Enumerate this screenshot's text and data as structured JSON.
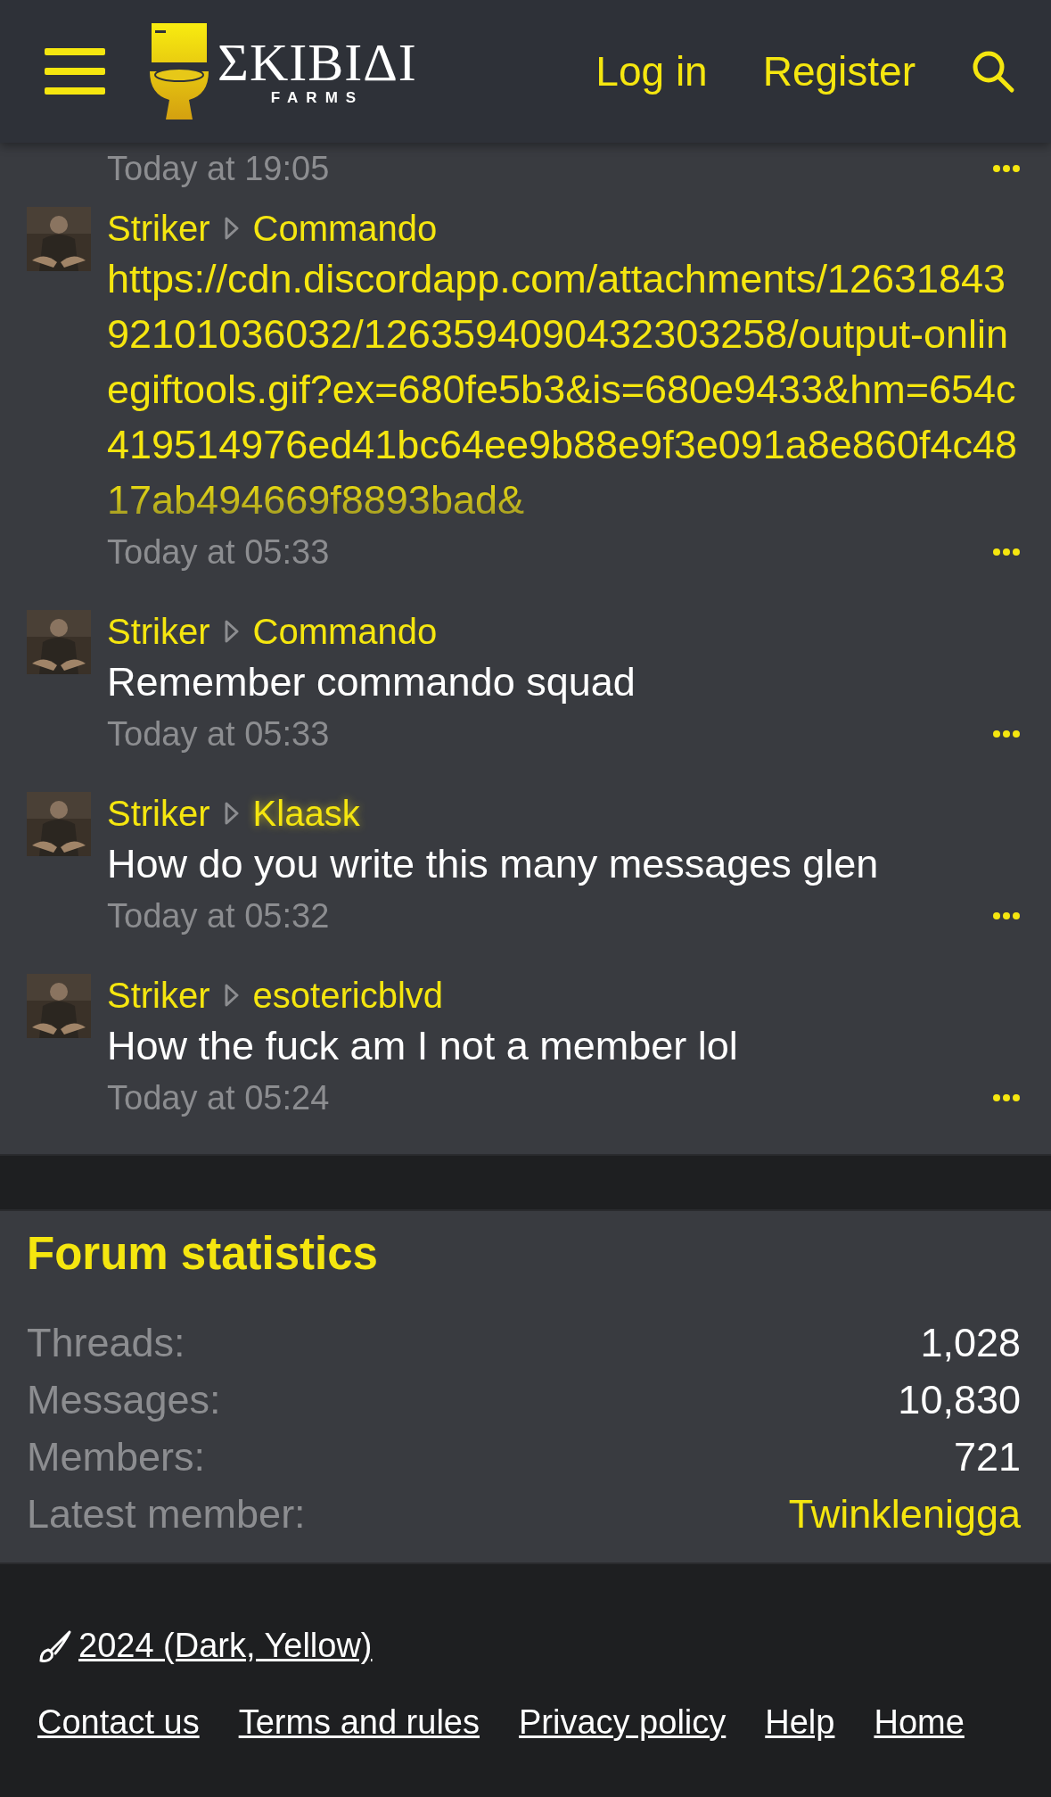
{
  "header": {
    "logo": {
      "title": "ΣKIBIΔI",
      "subtitle": "FARMS"
    },
    "links": [
      "Log in",
      "Register"
    ]
  },
  "posts": [
    {
      "kind": "stub",
      "time": "Today at 19:05"
    },
    {
      "author": "Striker",
      "target": "Commando",
      "target_glow": false,
      "kind": "link",
      "message": "https://cdn.discordapp.com/attachments/1263184392101036032/1263594090432303258/output-onlinegiftools.gif?ex=680fe5b3&is=680e9433&hm=654c419514976ed41bc64ee9b88e9f3e091a8e860f4c4817ab494669f8893bad&",
      "truncated": true,
      "time": "Today at 05:33"
    },
    {
      "author": "Striker",
      "target": "Commando",
      "target_glow": false,
      "kind": "text",
      "message": "Remember commando squad",
      "time": "Today at 05:33"
    },
    {
      "author": "Striker",
      "target": "Klaask",
      "target_glow": true,
      "kind": "text",
      "message": "How do you write this many messages glen",
      "time": "Today at 05:32"
    },
    {
      "author": "Striker",
      "target": "esotericblvd",
      "target_glow": false,
      "kind": "text",
      "message": "How the fuck am I not a member lol",
      "time": "Today at 05:24"
    }
  ],
  "stats": {
    "title": "Forum statistics",
    "rows": [
      {
        "label": "Threads:",
        "value": "1,028",
        "kind": "text"
      },
      {
        "label": "Messages:",
        "value": "10,830",
        "kind": "text"
      },
      {
        "label": "Members:",
        "value": "721",
        "kind": "text"
      },
      {
        "label": "Latest member:",
        "value": "Twinklenigga",
        "kind": "link"
      }
    ]
  },
  "footer": {
    "style": "2024 (Dark, Yellow)",
    "links": [
      "Contact us",
      "Terms and rules",
      "Privacy policy",
      "Help",
      "Home"
    ]
  }
}
